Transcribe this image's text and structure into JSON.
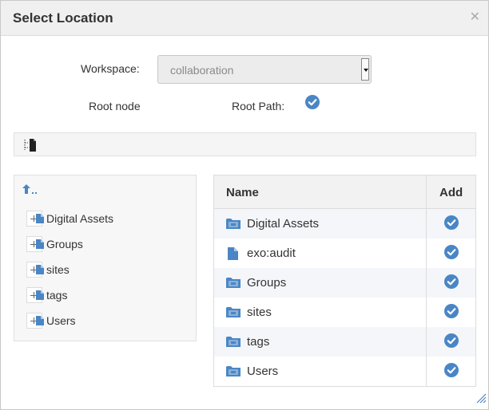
{
  "dialog": {
    "title": "Select Location"
  },
  "workspace": {
    "label": "Workspace:",
    "value": "collaboration"
  },
  "root": {
    "node_label": "Root node",
    "path_label": "Root Path:"
  },
  "tree": {
    "items": [
      {
        "label": "Digital Assets"
      },
      {
        "label": "Groups"
      },
      {
        "label": "sites"
      },
      {
        "label": "tags"
      },
      {
        "label": "Users"
      }
    ]
  },
  "table": {
    "headers": {
      "name": "Name",
      "add": "Add"
    },
    "rows": [
      {
        "name": "Digital Assets",
        "icon": "folder-icon"
      },
      {
        "name": "exo:audit",
        "icon": "file-icon"
      },
      {
        "name": "Groups",
        "icon": "folder-icon"
      },
      {
        "name": "sites",
        "icon": "folder-icon"
      },
      {
        "name": "tags",
        "icon": "folder-icon"
      },
      {
        "name": "Users",
        "icon": "folder-icon"
      }
    ]
  },
  "colors": {
    "accent": "#4a86c5",
    "header_bg": "#f0f0f0",
    "row_alt": "#f4f6f9"
  }
}
